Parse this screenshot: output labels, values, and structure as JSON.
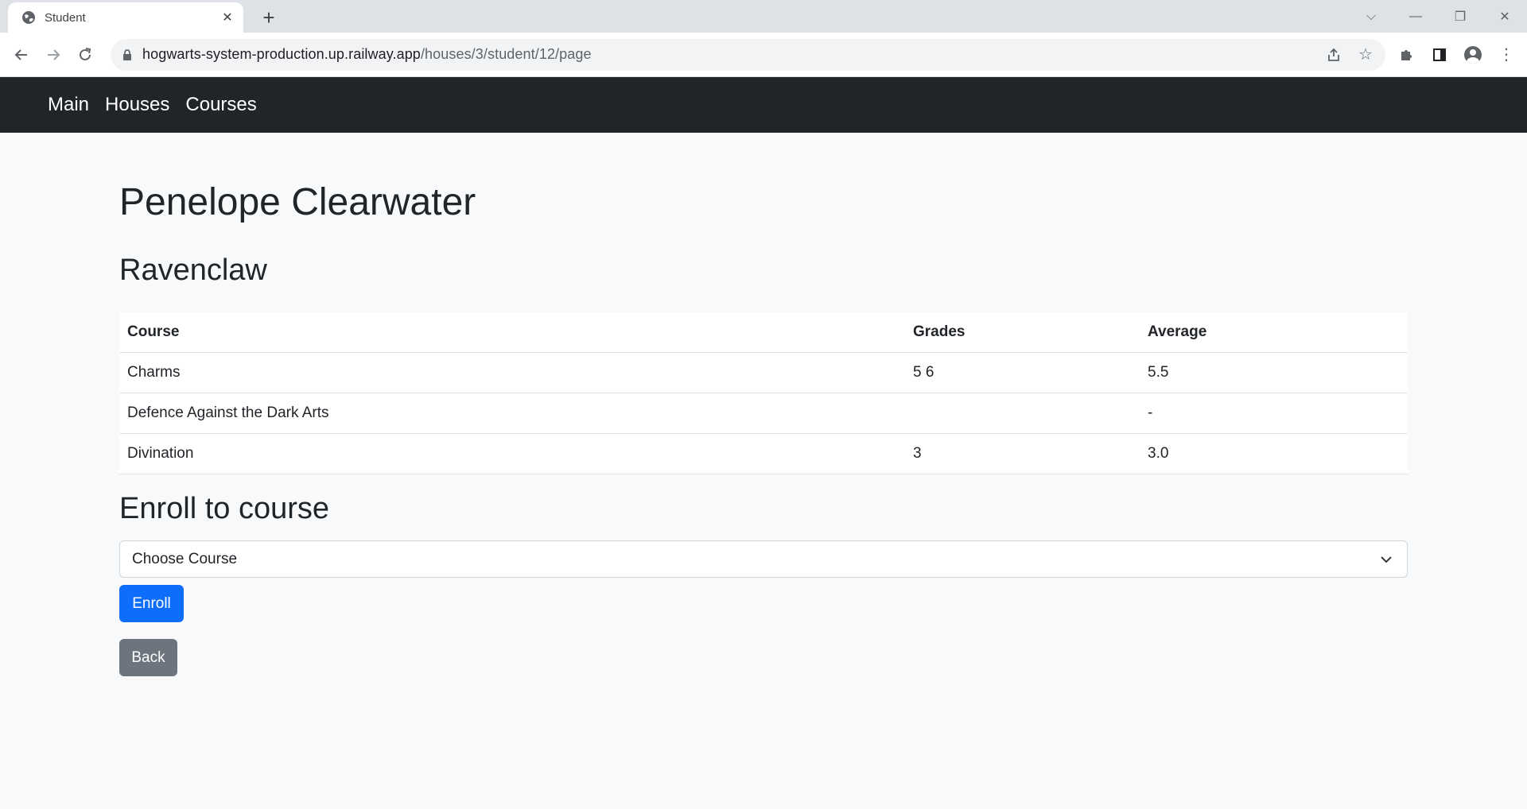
{
  "browser": {
    "tab_title": "Student",
    "url_domain": "hogwarts-system-production.up.railway.app",
    "url_path": "/houses/3/student/12/page"
  },
  "nav": {
    "items": [
      {
        "label": "Main"
      },
      {
        "label": "Houses"
      },
      {
        "label": "Courses"
      }
    ]
  },
  "student": {
    "name": "Penelope Clearwater",
    "house": "Ravenclaw"
  },
  "grades_table": {
    "headers": {
      "course": "Course",
      "grades": "Grades",
      "average": "Average"
    },
    "rows": [
      {
        "course": "Charms",
        "grades": "5 6",
        "average": "5.5"
      },
      {
        "course": "Defence Against the Dark Arts",
        "grades": "",
        "average": "-"
      },
      {
        "course": "Divination",
        "grades": "3",
        "average": "3.0"
      }
    ]
  },
  "enroll": {
    "title": "Enroll to course",
    "select_value": "Choose Course",
    "enroll_label": "Enroll",
    "back_label": "Back"
  },
  "colors": {
    "navbar": "#212529",
    "primary": "#0d6efd",
    "secondary": "#6c757d",
    "background": "#f8f9fa"
  },
  "icons": {
    "favicon": "globe-icon",
    "lock": "lock-icon",
    "share": "share-icon",
    "bookmark": "star-icon",
    "extensions": "puzzle-icon",
    "side_panel": "side-panel-icon",
    "profile": "profile-icon",
    "menu": "kebab-menu-icon"
  }
}
